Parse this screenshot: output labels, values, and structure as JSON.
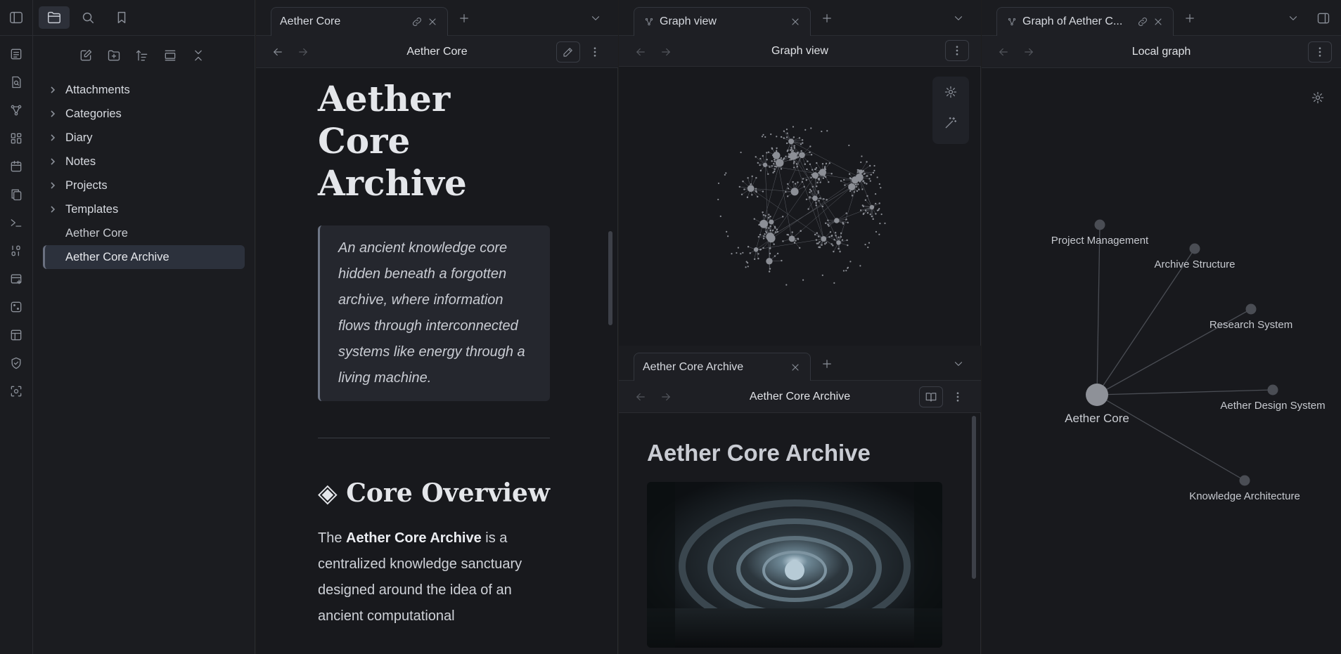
{
  "ribbon": {
    "icons": [
      "file-list-icon",
      "search-file-icon",
      "graph-icon",
      "canvas-icon",
      "calendar-icon",
      "copy-icon",
      "terminal-icon",
      "numbers-icon",
      "kanban-icon",
      "dice-icon",
      "layout-icon",
      "shield-check-icon",
      "scan-icon"
    ]
  },
  "sidebar": {
    "tree": {
      "folders": [
        "Attachments",
        "Categories",
        "Diary",
        "Notes",
        "Projects",
        "Templates"
      ],
      "files": [
        "Aether Core",
        "Aether Core Archive"
      ],
      "active_file": "Aether Core Archive"
    }
  },
  "pane1": {
    "tab_label": "Aether Core",
    "header_title": "Aether Core",
    "title": "Aether Core Archive",
    "callout": "An ancient knowledge core hidden beneath a forgotten archive, where information flows through interconnected systems like energy through a living machine.",
    "section_icon": "◈",
    "section_heading": "Core Overview",
    "para_pre": "The ",
    "para_bold": "Aether Core Archive",
    "para_post": " is a centralized knowledge sanctuary designed around the idea of an ancient computational"
  },
  "pane2": {
    "tab_label": "Graph view",
    "header_title": "Graph view",
    "sub_tab_label": "Aether Core Archive",
    "sub_header_title": "Aether Core Archive",
    "read_title": "Aether Core Archive"
  },
  "pane3": {
    "tab_label": "Graph of Aether C...",
    "header_title": "Local graph",
    "center_node": "Aether Core",
    "nodes": [
      {
        "label": "Project Management"
      },
      {
        "label": "Archive Structure"
      },
      {
        "label": "Research System"
      },
      {
        "label": "Aether Design System"
      },
      {
        "label": "Knowledge Architecture"
      }
    ]
  },
  "colors": {
    "background": "#18191d",
    "sidebar": "#1b1c20",
    "accent": "#6e7686",
    "node": "#4a4d54",
    "center_node": "#8e9198"
  }
}
